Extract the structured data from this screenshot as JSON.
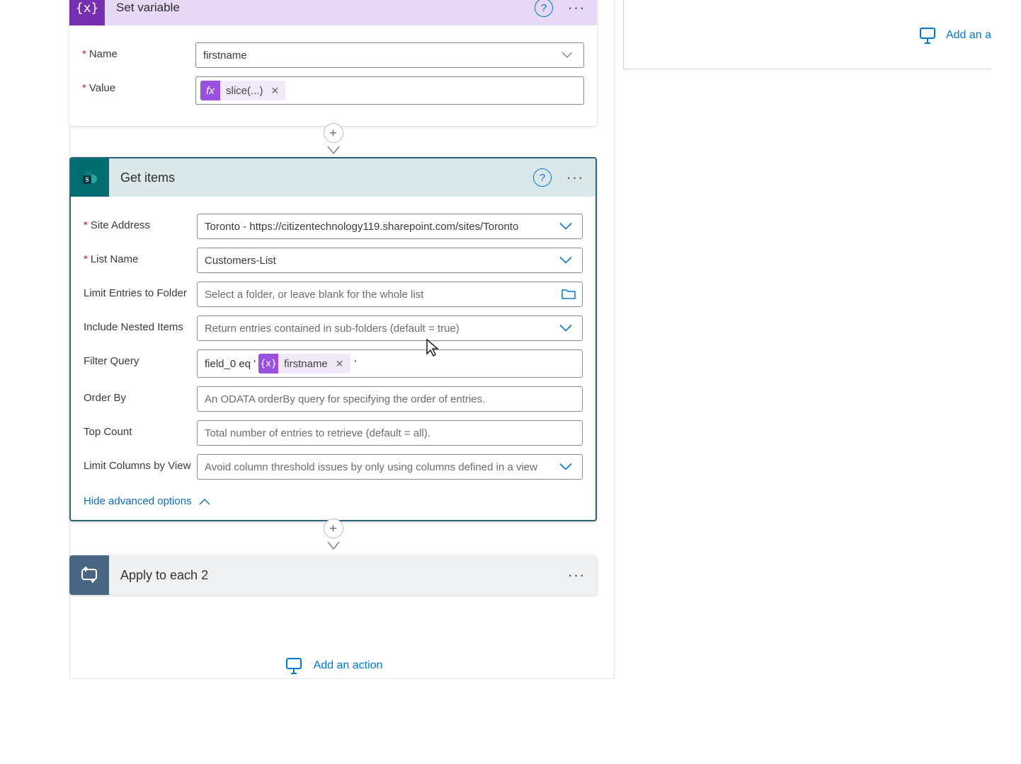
{
  "setvar": {
    "title": "Set variable",
    "name_label": "Name",
    "name_value": "firstname",
    "value_label": "Value",
    "token_fx": "fx",
    "token_label": "slice(...)"
  },
  "getitems": {
    "title": "Get items",
    "site_label": "Site Address",
    "site_value": "Toronto - https://citizentechnology119.sharepoint.com/sites/Toronto",
    "list_label": "List Name",
    "list_value": "Customers-List",
    "folder_label": "Limit Entries to Folder",
    "folder_placeholder": "Select a folder, or leave blank for the whole list",
    "nested_label": "Include Nested Items",
    "nested_placeholder": "Return entries contained in sub-folders (default = true)",
    "filter_label": "Filter Query",
    "filter_pretext": "field_0 eq '",
    "filter_token": "firstname",
    "filter_posttext": "'",
    "orderby_label": "Order By",
    "orderby_placeholder": "An ODATA orderBy query for specifying the order of entries.",
    "top_label": "Top Count",
    "top_placeholder": "Total number of entries to retrieve (default = all).",
    "limitcols_label": "Limit Columns by View",
    "limitcols_placeholder": "Avoid column threshold issues by only using columns defined in a view",
    "hide_adv": "Hide advanced options"
  },
  "applyto": {
    "title": "Apply to each 2"
  },
  "add_action": "Add an action",
  "right_add": "Add an a"
}
